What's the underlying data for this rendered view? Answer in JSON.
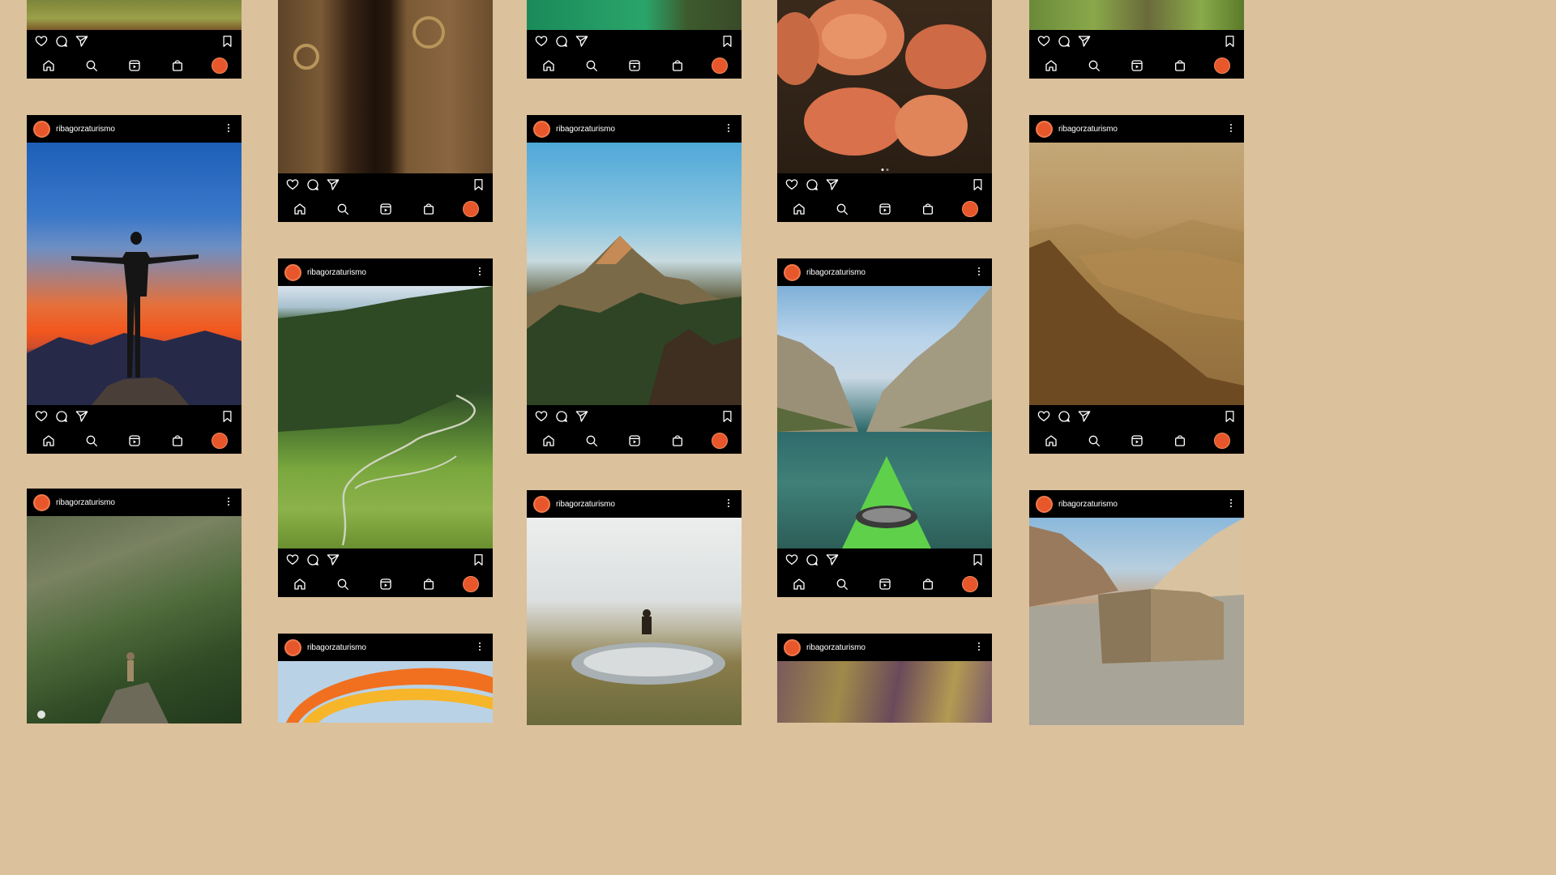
{
  "account": {
    "username": "ribagorzaturismo",
    "avatar_color": "#e8572c"
  },
  "background_color": "#dbc19c",
  "icons": {
    "like": "heart-icon",
    "comment": "comment-icon",
    "share": "paper-plane-icon",
    "save": "bookmark-icon",
    "home": "home-icon",
    "search": "search-icon",
    "reels": "reels-icon",
    "shop": "shop-bag-icon",
    "profile": "profile-avatar-icon"
  },
  "posts": [
    {
      "id": "c1p1",
      "image": "meadow with rocks"
    },
    {
      "id": "c1p2",
      "image": "hiker silhouette with arms outstretched at sunset"
    },
    {
      "id": "c1p3",
      "image": "hiker on a rock in a forested mountain valley"
    },
    {
      "id": "c2p1",
      "image": "ornate carved wooden door with knockers"
    },
    {
      "id": "c2p2",
      "image": "winding mountain road through green valley"
    },
    {
      "id": "c2p3",
      "image": "orange paraglider wing"
    },
    {
      "id": "c3p1",
      "image": "turquoise water and trees"
    },
    {
      "id": "c3p2",
      "image": "rocky mountain peak above pine forest"
    },
    {
      "id": "c3p3",
      "image": "person sitting by a mountain pond in fog"
    },
    {
      "id": "c4p1",
      "image": "orange milk-cap mushrooms"
    },
    {
      "id": "c4p2",
      "image": "green kayak in a canyon lake"
    },
    {
      "id": "c4p3",
      "image": "purple and yellow wildflowers"
    },
    {
      "id": "c5p1",
      "image": "green vegetation"
    },
    {
      "id": "c5p2",
      "image": "golden hazy mountain landscape"
    },
    {
      "id": "c5p3",
      "image": "stone ruin on a cliff in a gorge"
    }
  ]
}
